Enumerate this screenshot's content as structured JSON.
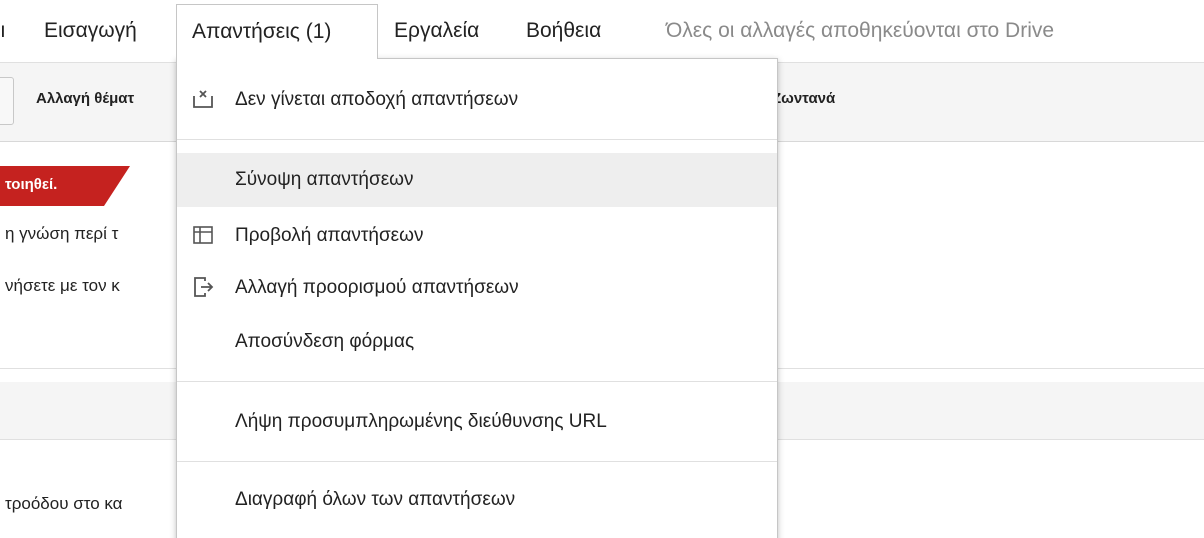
{
  "menubar": {
    "insert": "Εισαγωγή",
    "responses": "Απαντήσεις (1)",
    "tools": "Εργαλεία",
    "help": "Βοήθεια",
    "status": "Όλες οι αλλαγές αποθηκεύονται στο Drive"
  },
  "toolbar": {
    "change_theme": "Αλλαγή θέματ",
    "live_fragment": "Ζωντανά"
  },
  "content": {
    "banner_text": "τοιηθεί.",
    "line1": "η γνώση περί τ",
    "line2": "νήσετε με τον κ",
    "line3": "τροόδου στο κα"
  },
  "dropdown": {
    "items": [
      {
        "label": "Δεν γίνεται αποδοχή απαντήσεων",
        "icon": "not-accepting-icon"
      },
      {
        "label": "Σύνοψη απαντήσεων",
        "icon": ""
      },
      {
        "label": "Προβολή απαντήσεων",
        "icon": "table-icon"
      },
      {
        "label": "Αλλαγή προορισμού απαντήσεων",
        "icon": "change-destination-icon"
      },
      {
        "label": "Αποσύνδεση φόρμας",
        "icon": ""
      },
      {
        "label": "Λήψη προσυμπληρωμένης διεύθυνσης URL",
        "icon": ""
      },
      {
        "label": "Διαγραφή όλων των απαντήσεων",
        "icon": ""
      }
    ]
  },
  "colors": {
    "accent_red": "#c5221f",
    "highlight": "#eeeeee",
    "status_gray": "#8a8a8a"
  }
}
